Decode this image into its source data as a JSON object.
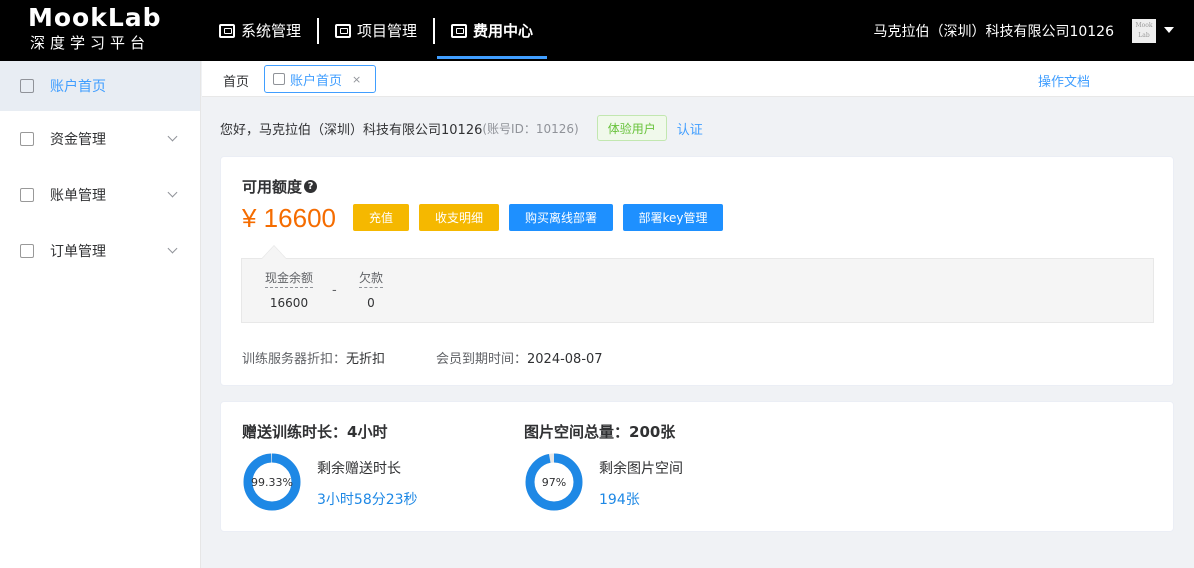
{
  "header": {
    "logo_title": "MookLab",
    "logo_subtitle": "深度学习平台",
    "nav": [
      {
        "label": "系统管理",
        "icon": "monitor-icon"
      },
      {
        "label": "项目管理",
        "icon": "briefcase-icon"
      },
      {
        "label": "费用中心",
        "icon": "wallet-icon",
        "active": true
      }
    ],
    "company": "马克拉伯（深圳）科技有限公司10126",
    "avatar_text": "Mook Lab"
  },
  "sidebar": {
    "items": [
      {
        "label": "账户首页",
        "active": true
      },
      {
        "label": "资金管理"
      },
      {
        "label": "账单管理"
      },
      {
        "label": "订单管理"
      }
    ]
  },
  "tabbar": {
    "home": "首页",
    "tab_label": "账户首页",
    "tab_close": "×",
    "docs": "操作文档"
  },
  "greeting": {
    "text": "您好，马克拉伯（深圳）科技有限公司10126",
    "account": "(账号ID：10126)",
    "badge": "体验用户",
    "verify": "认证"
  },
  "quota": {
    "title": "可用额度",
    "help": "?",
    "amount": "¥ 16600",
    "buttons": {
      "recharge": "充值",
      "details": "收支明细",
      "offline": "购买离线部署",
      "key": "部署key管理"
    },
    "cash_label": "现金余额",
    "cash_value": "16600",
    "dash": "-",
    "debt_label": "欠款",
    "debt_value": "0",
    "discount_key": "训练服务器折扣：",
    "discount_val": "无折扣",
    "expire_key": "会员到期时间：",
    "expire_val": "2024-08-07"
  },
  "stats": {
    "training": {
      "title": "赠送训练时长：4小时",
      "percent_label": "99.33%",
      "percent": 0.9933,
      "label": "剩余赠送时长",
      "value": "3小时58分23秒"
    },
    "images": {
      "title": "图片空间总量：200张",
      "percent_label": "97%",
      "percent": 0.97,
      "label": "剩余图片空间",
      "value": "194张"
    }
  },
  "colors": {
    "accent": "#409eff",
    "amount": "#f56c00",
    "donut": "#1e88e5",
    "button_yellow": "#f5b800",
    "button_blue": "#1e90ff"
  }
}
